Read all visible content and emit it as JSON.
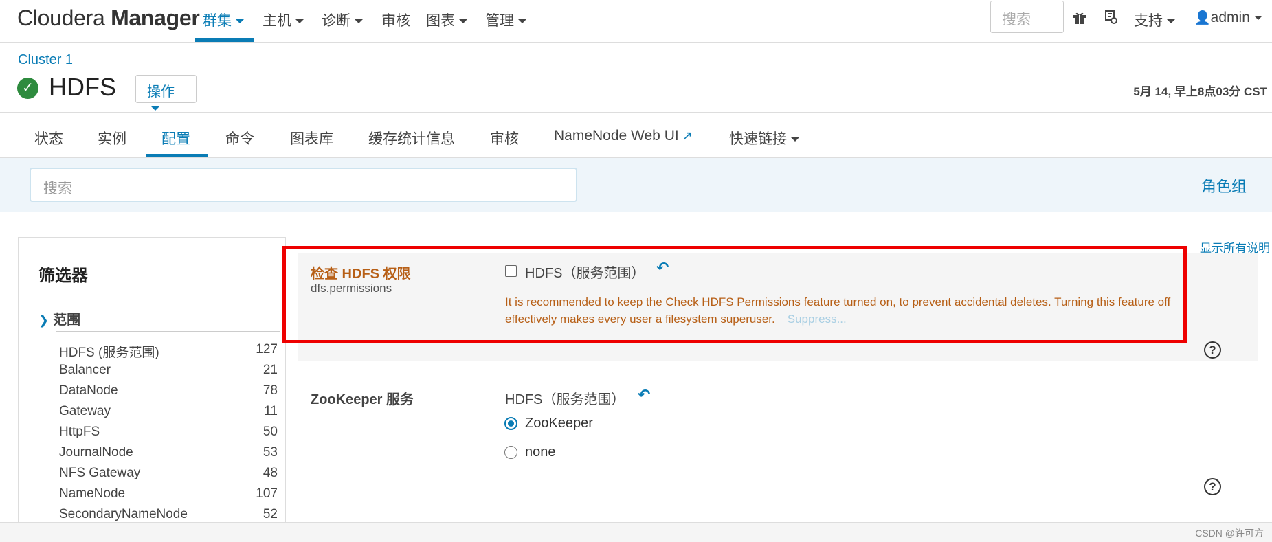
{
  "navbar": {
    "brand_light": "Cloudera",
    "brand_bold": "Manager",
    "items": [
      {
        "label": "群集",
        "dropdown": true,
        "active": true
      },
      {
        "label": "主机",
        "dropdown": true
      },
      {
        "label": "诊断",
        "dropdown": true
      },
      {
        "label": "审核",
        "dropdown": false
      },
      {
        "label": "图表",
        "dropdown": true
      },
      {
        "label": "管理",
        "dropdown": true
      }
    ],
    "search_placeholder": "搜索",
    "support_label": "支持",
    "user_label": "admin"
  },
  "service": {
    "cluster_name": "Cluster 1",
    "name": "HDFS",
    "status": "good-health",
    "actions_label": "操作",
    "timestamp": "5月 14, 早上8点03分 CST"
  },
  "tabs": [
    {
      "label": "状态"
    },
    {
      "label": "实例"
    },
    {
      "label": "配置",
      "active": true
    },
    {
      "label": "命令"
    },
    {
      "label": "图表库"
    },
    {
      "label": "缓存统计信息"
    },
    {
      "label": "审核"
    },
    {
      "label": "NameNode Web UI",
      "external": true
    },
    {
      "label": "快速链接",
      "dropdown": true
    }
  ],
  "config_search": {
    "placeholder": "搜索"
  },
  "role_groups_label": "角色组",
  "filters": {
    "title": "筛选器",
    "scope_heading": "范围",
    "items": [
      {
        "label": "HDFS (服务范围)",
        "count": "127"
      },
      {
        "label": "Balancer",
        "count": "21"
      },
      {
        "label": "DataNode",
        "count": "78"
      },
      {
        "label": "Gateway",
        "count": "11"
      },
      {
        "label": "HttpFS",
        "count": "50"
      },
      {
        "label": "JournalNode",
        "count": "53"
      },
      {
        "label": "NFS Gateway",
        "count": "48"
      },
      {
        "label": "NameNode",
        "count": "107"
      },
      {
        "label": "SecondaryNameNode",
        "count": "52"
      }
    ]
  },
  "show_all_descriptions": "显示所有说明",
  "configs": [
    {
      "title": "检查 HDFS 权限",
      "key": "dfs.permissions",
      "scope_label": "HDFS（服务范围）",
      "checked": false,
      "warning": "It is recommended to keep the Check HDFS Permissions feature turned on, to prevent accidental deletes. Turning this feature off effectively makes every user a filesystem superuser.",
      "suppress_label": "Suppress..."
    },
    {
      "title": "ZooKeeper 服务",
      "scope_label": "HDFS（服务范围）",
      "options": [
        {
          "label": "ZooKeeper",
          "selected": true
        },
        {
          "label": "none",
          "selected": false
        }
      ]
    }
  ],
  "watermark": "CSDN @许可方",
  "colors": {
    "accent": "#0a7cb5",
    "warning": "#b75f16",
    "highlight": "#ee0000",
    "status_ok": "#2e8b3e"
  }
}
